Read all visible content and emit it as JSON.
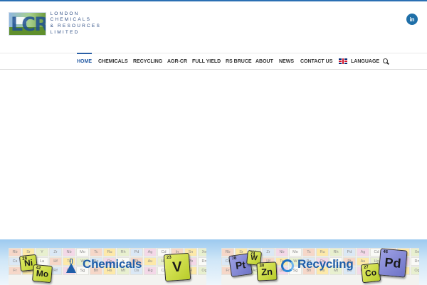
{
  "header": {
    "logo_letters": "LCR",
    "logo_lines": [
      "LONDON",
      "CHEMICALS",
      "& RESOURCES",
      "LIMITED"
    ],
    "linkedin_label": "in"
  },
  "nav": {
    "items": [
      "HOME",
      "CHEMICALS",
      "RECYCLING",
      "AGR-CR",
      "FULL YIELD",
      "RS BRUCE",
      "ABOUT",
      "NEWS",
      "CONTACT US",
      "LANGUAGE"
    ],
    "active": "HOME"
  },
  "banner": {
    "chemicals": {
      "label": "Chemicals",
      "tiles": [
        {
          "symbol": "Ni",
          "number": "28"
        },
        {
          "symbol": "Mo",
          "number": "42"
        },
        {
          "symbol": "V",
          "number": "23"
        }
      ]
    },
    "recycling": {
      "label": "Recycling",
      "tiles": [
        {
          "symbol": "Pt",
          "number": "78"
        },
        {
          "symbol": "W",
          "number": "74"
        },
        {
          "symbol": "Zn",
          "number": "30"
        },
        {
          "symbol": "Co",
          "number": "27"
        },
        {
          "symbol": "Pd",
          "number": "46"
        }
      ]
    },
    "periodic_rows": [
      [
        "Rb",
        "Sr",
        "Y",
        "Zr",
        "Nb",
        "Mo",
        "Tc",
        "Ru",
        "Rh",
        "Pd",
        "Ag",
        "Cd",
        "In",
        "Sn",
        "Xe"
      ],
      [
        "Cs",
        "Ba",
        "La",
        "Hf",
        "Ta",
        "W",
        "Re",
        "Os",
        "Ir",
        "Pt",
        "Au",
        "Hg",
        "Tl",
        "Pb",
        "Rn"
      ],
      [
        "Fr",
        "Ra",
        "Ac",
        "Rf",
        "Db",
        "Sg",
        "Bh",
        "Hs",
        "Mt",
        "Ds",
        "Rg",
        "Cn",
        "Nh",
        "Fl",
        "Og"
      ]
    ]
  },
  "colors": {
    "accent": "#2a5fa6",
    "banner_text": "#1f5ea8",
    "tile_lime": "#c9d83c",
    "tile_purple": "#7f84d4"
  }
}
